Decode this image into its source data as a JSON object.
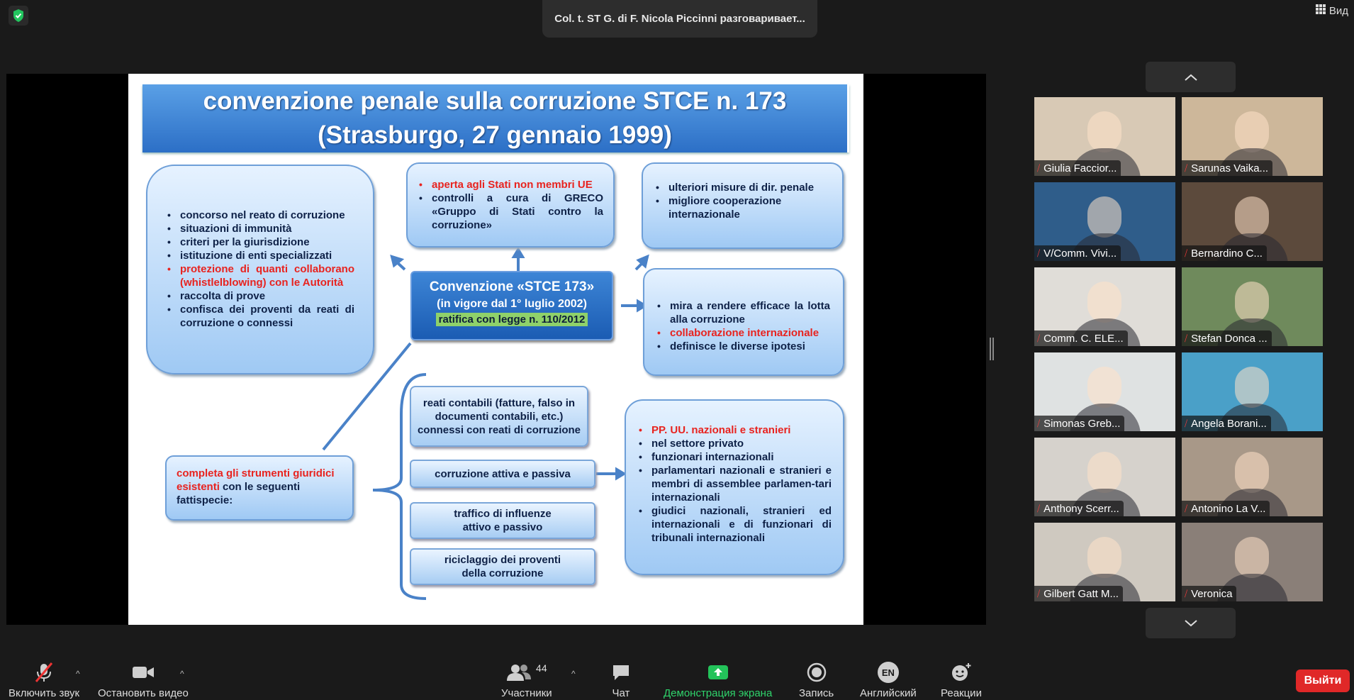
{
  "app": {
    "speaker_text": "Col. t. ST G. di F. Nicola Piccinni разговаривает...",
    "view_label": "Вид"
  },
  "slide": {
    "title_line1": "convenzione penale sulla corruzione STCE n. 173",
    "title_line2": "(Strasburgo, 27 gennaio 1999)",
    "left_box": [
      "concorso nel reato di corruzione",
      "situazioni di immunità",
      "criteri per la giurisdizione",
      "istituzione di enti specializzati",
      "protezione di quanti collaborano (whistlelblowing) con le Autorità",
      "raccolta di prove",
      "confisca dei proventi da reati di corruzione o connessi"
    ],
    "top_box": [
      "aperta agli Stati non membri UE",
      "controlli a cura di GRECO «Gruppo di Stati contro la corruzione»"
    ],
    "right_top_box": [
      "ulteriori misure di dir. penale",
      "migliore cooperazione internazionale"
    ],
    "center_title": "Convenzione «STCE 173»",
    "center_sub": "(in vigore dal 1° luglio 2002)",
    "center_green": "ratifica con legge n. 110/2012",
    "right_mid_box": [
      "mira a rendere efficace la lotta alla corruzione",
      "collaborazione internazionale",
      "definisce le diverse ipotesi"
    ],
    "completa_red": "completa gli strumenti giuridici esistenti",
    "completa_rest": " con le seguenti fattispecie:",
    "reati_box": "reati contabili (fatture, falso in documenti contabili, etc.) connessi con reati di corruzione",
    "corruzione_box": "corruzione attiva e passiva",
    "traffico_box": "traffico di influenze attivo e passivo",
    "riciclaggio_box": "riciclaggio dei proventi della corruzione",
    "pp_box": [
      "PP. UU. nazionali e stranieri",
      "nel settore privato",
      "funzionari internazionali",
      "parlamentari nazionali e stranieri e membri di assemblee parlamen-tari internazionali",
      "giudici nazionali, stranieri ed internazionali e di funzionari di tribunali internazionali"
    ]
  },
  "participants": [
    {
      "name": "Giulia Faccior...",
      "bg": "#d8c9b5"
    },
    {
      "name": "Sarunas Vaika...",
      "bg": "#cdb79a"
    },
    {
      "name": "V/Comm. Vivi...",
      "bg": "#2f5d8a"
    },
    {
      "name": "Bernardino C...",
      "bg": "#5c4a3c"
    },
    {
      "name": "Comm. C. ELE...",
      "bg": "#e0ddd8"
    },
    {
      "name": "Stefan Donca ...",
      "bg": "#6f8a5c"
    },
    {
      "name": "Simonas Greb...",
      "bg": "#dfe2e2"
    },
    {
      "name": "Angela Borani...",
      "bg": "#4aa0c8"
    },
    {
      "name": "Anthony Scerr...",
      "bg": "#d6d2cc"
    },
    {
      "name": "Antonino La V...",
      "bg": "#a89888"
    },
    {
      "name": "Gilbert Gatt M...",
      "bg": "#cfc9c0"
    },
    {
      "name": "Veronica",
      "bg": "#8a7f78"
    }
  ],
  "toolbar": {
    "mute": "Включить звук",
    "video": "Остановить видео",
    "participants": "Участники",
    "participants_count": "44",
    "chat": "Чат",
    "share": "Демонстрация экрана",
    "record": "Запись",
    "lang_badge": "EN",
    "lang": "Английский",
    "reactions": "Реакции",
    "exit": "Выйти"
  }
}
